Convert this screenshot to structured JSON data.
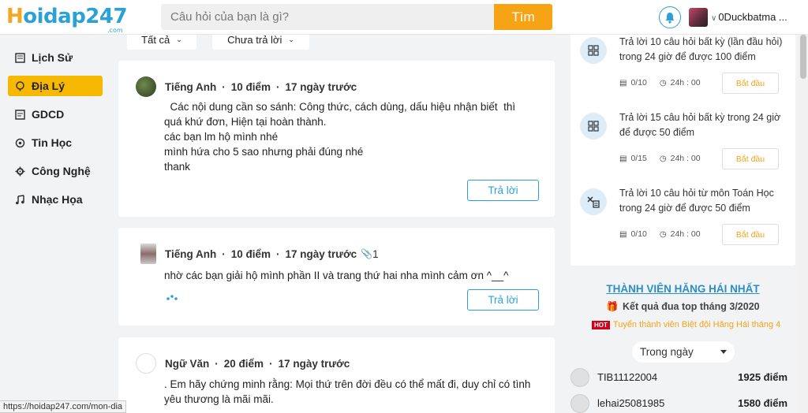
{
  "header": {
    "logo_h": "H",
    "logo_rest": "oidap247",
    "logo_com": ".com",
    "search_placeholder": "Câu hỏi của bạn là gì?",
    "search_button": "Tìm",
    "username": "0Duckbatma ..."
  },
  "sidebar": {
    "items": [
      {
        "label": "Lịch Sử",
        "icon": "history-icon"
      },
      {
        "label": "Địa Lý",
        "icon": "globe-icon"
      },
      {
        "label": "GDCD",
        "icon": "book-icon"
      },
      {
        "label": "Tin Học",
        "icon": "computer-icon"
      },
      {
        "label": "Công Nghệ",
        "icon": "gear-icon"
      },
      {
        "label": "Nhạc Họa",
        "icon": "music-icon"
      }
    ]
  },
  "filters": {
    "all": "Tất cả",
    "unanswered": "Chưa trả lời"
  },
  "questions": [
    {
      "subject": "Tiếng Anh",
      "points": "10 điểm",
      "time": "17 ngày trước",
      "lines": [
        "  Các nội dung cần so sánh: Công thức, cách dùng, dấu hiệu nhận biết  thì quá khứ đơn, Hiện tại hoàn thành.",
        "các bạn lm hộ mình nhé",
        "mình hứa cho 5 sao nhưng phải đúng nhé",
        "thank"
      ],
      "reply": "Trả lời"
    },
    {
      "subject": "Tiếng Anh",
      "points": "10 điểm",
      "time": "17 ngày trước",
      "attachments": "1",
      "lines": [
        "nhờ các bạn giải hộ mình phần II và trang thứ hai nha mình cảm ơn ^__^"
      ],
      "reply": "Trả lời"
    },
    {
      "subject": "Ngữ Văn",
      "points": "20 điểm",
      "time": "17 ngày trước",
      "lines": [
        ". Em hãy chứng minh rằng: Mọi thứ trên đời đều có thể mất đi, duy chỉ có tình yêu thương là mãi mãi."
      ]
    }
  ],
  "tasks": [
    {
      "text": "Trả lời 10 câu hỏi  bất kỳ (lần đầu hỏi) trong 24 giờ để được 100 điểm",
      "progress": "0/10",
      "time": "24h : 00",
      "button": "Bắt đầu"
    },
    {
      "text": "Trả lời 15 câu hỏi  bất kỳ  trong 24 giờ để được 50 điểm",
      "progress": "0/15",
      "time": "24h : 00",
      "button": "Bắt đầu"
    },
    {
      "text": "Trả lời 10 câu hỏi  từ môn Toán Học trong 24 giờ để được 50 điểm",
      "progress": "0/10",
      "time": "24h : 00",
      "button": "Bắt đầu"
    }
  ],
  "leaderboard": {
    "title": "THÀNH VIÊN HĂNG HÁI NHẤT",
    "subtitle": "Kết quả đua top tháng 3/2020",
    "hot_badge": "HOT",
    "hot_text": "Tuyển thành viên Biệt đội Hăng Hái tháng 4",
    "period": "Trong ngày",
    "rows": [
      {
        "name": "TIB11122004",
        "points": "1925 điểm"
      },
      {
        "name": "lehai25081985",
        "points": "1580 điểm"
      }
    ]
  },
  "statusbar": "https://hoidap247.com/mon-dia",
  "colors": {
    "accent": "#2aa2d8",
    "brand": "#f6a316",
    "active": "#f6b800"
  }
}
